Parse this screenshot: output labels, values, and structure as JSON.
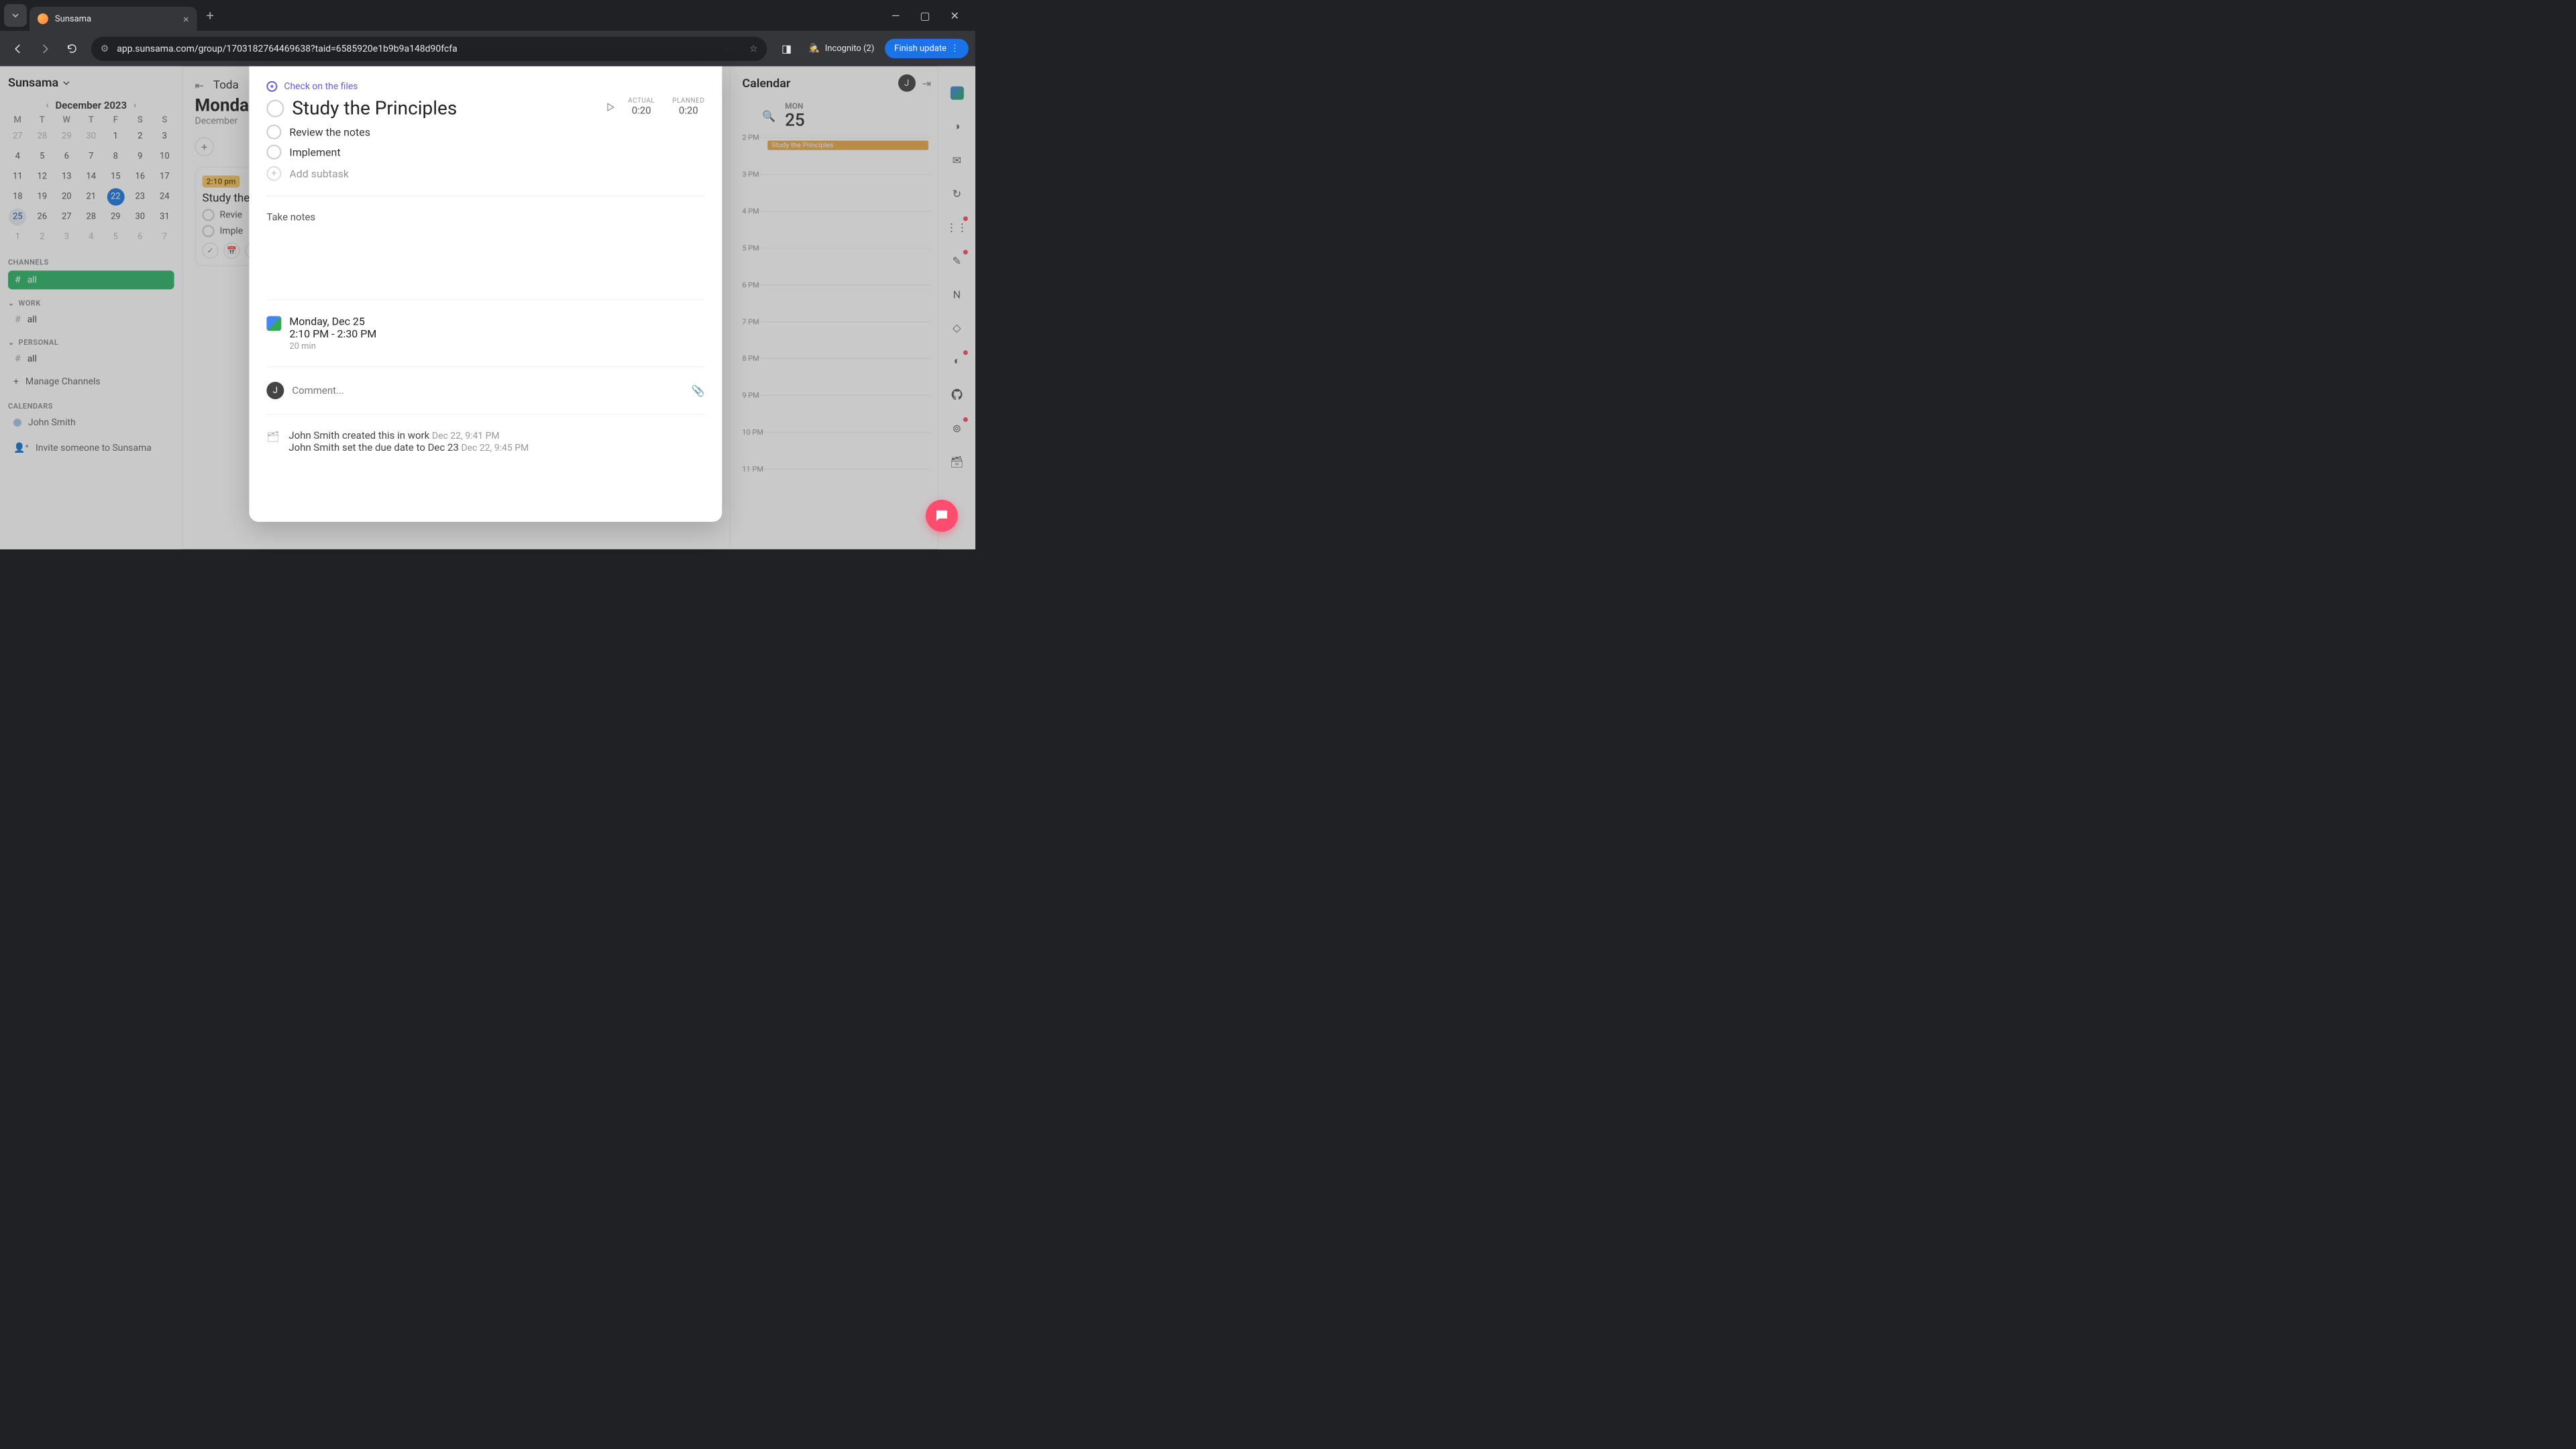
{
  "browser": {
    "tab_title": "Sunsama",
    "url": "app.sunsama.com/group/1703182764469638?taid=6585920e1b9b9a148d90fcfa",
    "incognito": "Incognito (2)",
    "finish_update": "Finish update"
  },
  "sidebar": {
    "workspace": "Sunsama",
    "month": "December 2023",
    "dow": [
      "M",
      "T",
      "W",
      "T",
      "F",
      "S",
      "S"
    ],
    "weeks": [
      [
        "27",
        "28",
        "29",
        "30",
        "1",
        "2",
        "3"
      ],
      [
        "4",
        "5",
        "6",
        "7",
        "8",
        "9",
        "10"
      ],
      [
        "11",
        "12",
        "13",
        "14",
        "15",
        "16",
        "17"
      ],
      [
        "18",
        "19",
        "20",
        "21",
        "22",
        "23",
        "24"
      ],
      [
        "25",
        "26",
        "27",
        "28",
        "29",
        "30",
        "31"
      ],
      [
        "1",
        "2",
        "3",
        "4",
        "5",
        "6",
        "7"
      ]
    ],
    "today": "22",
    "selected": "25",
    "channels_label": "CHANNELS",
    "channel_all": "all",
    "work_label": "WORK",
    "work_all": "all",
    "personal_label": "PERSONAL",
    "personal_all": "all",
    "manage": "Manage Channels",
    "calendars_label": "CALENDARS",
    "calendar_user": "John Smith",
    "invite": "Invite someone to Sunsama"
  },
  "main": {
    "today": "Toda",
    "heading": "Monda",
    "subheading": "December",
    "card": {
      "time": "2:10 pm",
      "title": "Study the",
      "sub1": "Revie",
      "sub2": "Imple"
    }
  },
  "modal": {
    "parent": "Check on the files",
    "title": "Study the Principles",
    "actual_label": "ACTUAL",
    "actual_value": "0:20",
    "planned_label": "PLANNED",
    "planned_value": "0:20",
    "sub1": "Review the notes",
    "sub2": "Implement",
    "add_subtask": "Add subtask",
    "notes": "Take notes",
    "sched_date": "Monday, Dec 25",
    "sched_time": "2:10 PM - 2:30 PM",
    "sched_dur": "20 min",
    "comment_placeholder": "Comment...",
    "avatar_initial": "J",
    "act1_text": "John Smith created this in work",
    "act1_ts": "Dec 22, 9:41 PM",
    "act2_text": "John Smith set the due date to Dec 23",
    "act2_ts": "Dec 22, 9:45 PM"
  },
  "calendar": {
    "title": "Calendar",
    "avatar": "J",
    "dow": "MON",
    "daynum": "25",
    "hours": [
      "2 PM",
      "3 PM",
      "4 PM",
      "5 PM",
      "6 PM",
      "7 PM",
      "8 PM",
      "9 PM",
      "10 PM",
      "11 PM"
    ],
    "event_title": "Study the Principles"
  }
}
